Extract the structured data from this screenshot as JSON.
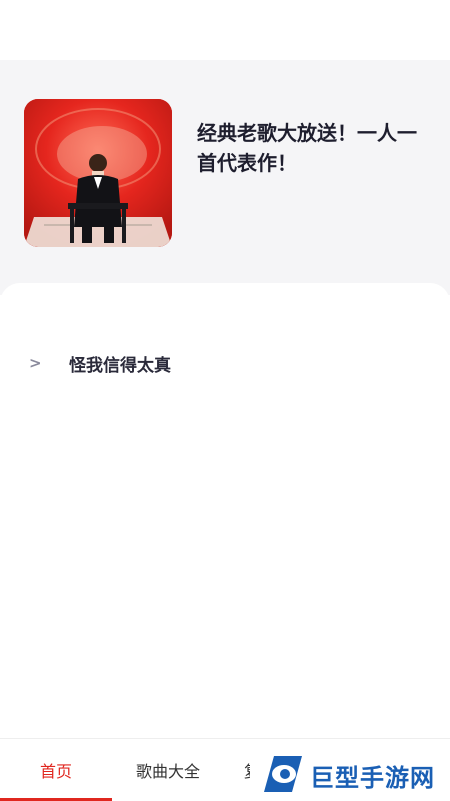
{
  "album": {
    "cover_name": "album-cover",
    "title": "经典老歌大放送！一人一首代表作！"
  },
  "songs": [
    {
      "arrow": ">",
      "title": "怪我信得太真"
    }
  ],
  "bottom_nav": {
    "tabs": [
      {
        "label": "首页",
        "active": true
      },
      {
        "label": "歌曲大全",
        "active": false
      },
      {
        "label": "复",
        "active": false
      }
    ],
    "active_color": "#e0271f"
  },
  "watermark": {
    "text": "巨型手游网"
  },
  "colors": {
    "header_bg": "#f5f5f7",
    "accent": "#e0271f",
    "cover_red": "#d8221c"
  }
}
